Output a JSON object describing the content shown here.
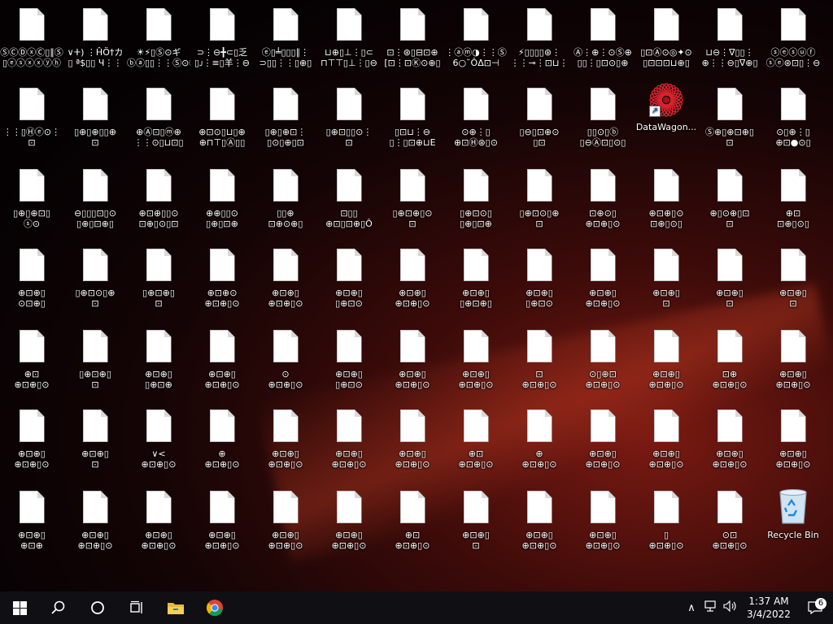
{
  "taskbar": {
    "time": "1:37 AM",
    "date": "3/4/2022",
    "notification_count": "6",
    "buttons": [
      "windows-start-icon",
      "search-icon",
      "cortana-icon",
      "task-view-icon",
      "file-explorer-icon",
      "chrome-icon"
    ],
    "tray": [
      "chevron-up-icon",
      "network-icon",
      "volume-icon"
    ]
  },
  "desktop": {
    "rows": [
      [
        [
          "ⓈⒸⒹⓧⒸ▯∥Ⓢ",
          "▯ⓔⓢⓧⓧⓨⓗ"
        ],
        [
          "∨ⵜ) ⋮ĤÖ†カ",
          "▯ ª$▯▯ Ч⋮⋮"
        ],
        [
          "☀⚡▯Ⓢ⊙ギ",
          "ⓑⓐ▯▯⋮⋮Ⓢ⊙ⓠ"
        ],
        [
          "⊃⋮⊖╋⊂▯乏",
          "▯ᴊ⋮≡▯羊⋮⊖"
        ],
        [
          "ⓔ▯╧▯▯▯∥⋮",
          "⊃▯▯⋮⋮▯⊕▯"
        ],
        [
          "⊔⊕▯⊥⋮▯⊂",
          "⊓⊤⊤▯⊥⋮▯⊖"
        ],
        [
          "⊡⋮⊛▯⊟⊡⊕",
          "[⊡⋮⊡Ⓚ⊙⊕▯"
        ],
        [
          "⋮ⓐⓜ◑⋮⋮Ⓢ",
          "6○˘ÔΔ⊡⊣"
        ],
        [
          "⚡▯▯▯▯⊛⋮",
          "⋮⋮⊸⋮⊡⊔⋮"
        ],
        [
          "Ⓐ⋮⊕⋮⊙Ⓢ⊕",
          "▯▯⋮▯⊡⊙▯⊕"
        ],
        [
          "▯⊡Ⓐ⊙◎✦⊙",
          "▯⊡⊡⊡⊔⊕▯"
        ],
        [
          "⊔⊖⋮∇▯▯⋮",
          "⊕⋮⋮⊖▯∇⊕▯"
        ],
        [
          "ⓢⓔⓢⓤⓕ",
          "ⓢⓔ⊛⊡▯⋮⊖"
        ]
      ],
      [
        [
          "⋮⋮▯Ⓗⓔ⊙⋮",
          "⊡"
        ],
        [
          "▯⊕▯⊕▯▯⊕",
          "⊡"
        ],
        [
          "⊕Ⓐ⊡▯ⓜ⊕",
          "⋮⋮⊙▯⊔⊡▯"
        ],
        [
          "⊕⊡⊙▯⊔▯⊕",
          "⊕⊓⊤▯Ⓐ▯▯"
        ],
        [
          "▯⊕▯⊕⊡⋮",
          "▯⊙▯⊕▯⊡"
        ],
        [
          "▯⊕⊡▯▯⊙⋮",
          "⊡"
        ],
        [
          "▯⊡⊔⋮⊖",
          "▯⋮▯⊡⊕⊔E"
        ],
        [
          "⊙⊕⋮▯",
          "⊕⊡Ⓗ⊛▯⊙"
        ],
        [
          "▯⊖▯⊡⊕⊙",
          "▯⊡"
        ],
        [
          "▯▯⊙▯ⓑ",
          "▯⊖Ⓐ⊡▯⊙▯"
        ],
        [
          "DataWagon...",
          ""
        ],
        [
          "Ⓢ⊕▯⊕⊡⊕▯",
          "⊡"
        ],
        [
          "⊙▯⊕⋮▯",
          "⊕⊡●⊙▯"
        ]
      ],
      [
        [
          "▯⊕▯⊕⊡▯",
          "ⓢ⊙"
        ],
        [
          "⊖▯▯▯⊡▯⊙",
          "▯⊕▯⊡⊕▯"
        ],
        [
          "⊕⊡⊕▯▯⊙",
          "⊡⊕▯⊙▯⊡"
        ],
        [
          "⊕⊕▯▯⊙",
          "▯⊕▯⊡⊕"
        ],
        [
          "▯▯⊕",
          "⊡⊕⊙⊕▯"
        ],
        [
          "⊡▯▯",
          "⊕⊡▯⊡⊕▯Ô"
        ],
        [
          "▯⊕⊡⊕▯⊙",
          "⊡"
        ],
        [
          "▯⊕⊡⊙▯",
          "▯⊕▯⊡⊕"
        ],
        [
          "▯⊕⊡⊙▯⊕",
          "⊡"
        ],
        [
          "⊡⊕⊙▯",
          "⊕⊡⊕▯⊙"
        ],
        [
          "⊕⊡⊕▯⊙",
          "⊡⊕▯⊙▯"
        ],
        [
          "⊕▯⊙⊕▯⊡",
          "⊡"
        ],
        [
          "⊕⊡",
          "⊡⊕▯⊙▯"
        ]
      ],
      [
        [
          "⊕⊡⊕▯",
          "⊙⊡⊕▯"
        ],
        [
          "▯⊕⊡⊙▯⊕",
          "⊡"
        ],
        [
          "▯⊕⊡⊕▯",
          "⊡"
        ],
        [
          "⊕⊡⊕⊙",
          "⊕⊡⊕▯⊙"
        ],
        [
          "⊕⊡⊕▯",
          "⊕⊡⊕▯⊙"
        ],
        [
          "⊕⊡⊕▯",
          "▯⊕⊡⊙"
        ],
        [
          "⊕⊡⊕▯",
          "⊕⊡⊕▯⊙"
        ],
        [
          "⊕⊡⊕▯",
          "▯⊕⊡⊕▯"
        ],
        [
          "⊕⊡⊕▯",
          "▯⊕⊡⊙"
        ],
        [
          "⊕⊡⊕▯",
          "⊕⊡⊕▯⊙"
        ],
        [
          "⊕⊡⊕▯",
          "⊡"
        ],
        [
          "⊕⊡⊕▯",
          "⊡"
        ],
        [
          "⊕⊡⊕▯",
          "⊡"
        ]
      ],
      [
        [
          "⊕⊡",
          "⊕⊡⊕▯⊙"
        ],
        [
          "▯⊕⊡⊕▯",
          "⊡"
        ],
        [
          "⊕⊡⊕▯",
          "▯⊕⊡⊕"
        ],
        [
          "⊕⊡⊕▯",
          "⊕⊡⊕▯⊙"
        ],
        [
          "⊙",
          "⊕⊡⊕▯⊙"
        ],
        [
          "⊕⊡⊕▯",
          "▯⊕⊡⊙"
        ],
        [
          "⊕⊡⊕▯",
          "⊕⊡⊕▯⊙"
        ],
        [
          "⊕⊡⊕▯",
          "⊕⊡⊕▯⊙"
        ],
        [
          "⊡",
          "⊕⊡⊕▯⊙"
        ],
        [
          "⊙▯⊕⊡",
          "⊕⊡⊕▯⊙"
        ],
        [
          "⊕⊡⊕▯",
          "⊕⊡⊕▯⊙"
        ],
        [
          "⊡⊕",
          "⊕⊡⊕▯⊙"
        ],
        [
          "⊕⊡⊕▯",
          "⊕⊡⊕▯⊙"
        ]
      ],
      [
        [
          "⊕⊡⊕▯",
          "⊕⊡⊕▯⊙"
        ],
        [
          "⊕⊡⊕▯",
          "⊡"
        ],
        [
          "∨<",
          "⊕⊡⊕▯⊙"
        ],
        [
          "⊕",
          "⊕⊡⊕▯⊙"
        ],
        [
          "⊕⊡⊕▯",
          "⊕⊡⊕▯⊙"
        ],
        [
          "⊕⊡⊕▯",
          "⊕⊡⊕▯⊙"
        ],
        [
          "⊕⊡⊕▯",
          "⊕⊡⊕▯⊙"
        ],
        [
          "⊕⊡",
          "⊕⊡⊕▯⊙"
        ],
        [
          "⊕",
          "⊕⊡⊕▯⊙"
        ],
        [
          "⊕⊡⊕▯",
          "⊕⊡⊕▯⊙"
        ],
        [
          "⊕⊡⊕▯",
          "⊕⊡⊕▯⊙"
        ],
        [
          "⊕⊡⊕▯",
          "⊕⊡⊕▯⊙"
        ],
        [
          "⊕⊡⊕▯",
          "⊕⊡⊕▯⊙"
        ]
      ],
      [
        [
          "⊕⊡⊕▯",
          "⊕⊡⊕"
        ],
        [
          "⊕⊡⊕▯",
          "⊕⊡⊕▯⊙"
        ],
        [
          "⊕⊡⊕▯",
          "⊕⊡⊕▯⊙"
        ],
        [
          "⊕⊡⊕▯",
          "⊕⊡⊕▯⊙"
        ],
        [
          "⊕⊡⊕▯",
          "⊕⊡⊕▯⊙"
        ],
        [
          "⊕⊡⊕▯",
          "⊕⊡⊕▯⊙"
        ],
        [
          "⊕⊡",
          "⊕⊡⊕▯⊙"
        ],
        [
          "⊕⊡⊕▯",
          "⊡"
        ],
        [
          "⊕⊡⊕▯",
          "⊕⊡⊕▯⊙"
        ],
        [
          "⊕⊡⊕▯",
          "⊕⊡⊕▯⊙"
        ],
        [
          "▯",
          "⊕⊡⊕▯⊙"
        ],
        [
          "⊙⊡",
          "⊕⊡⊕▯⊙"
        ],
        [
          "Recycle Bin",
          ""
        ]
      ]
    ]
  }
}
